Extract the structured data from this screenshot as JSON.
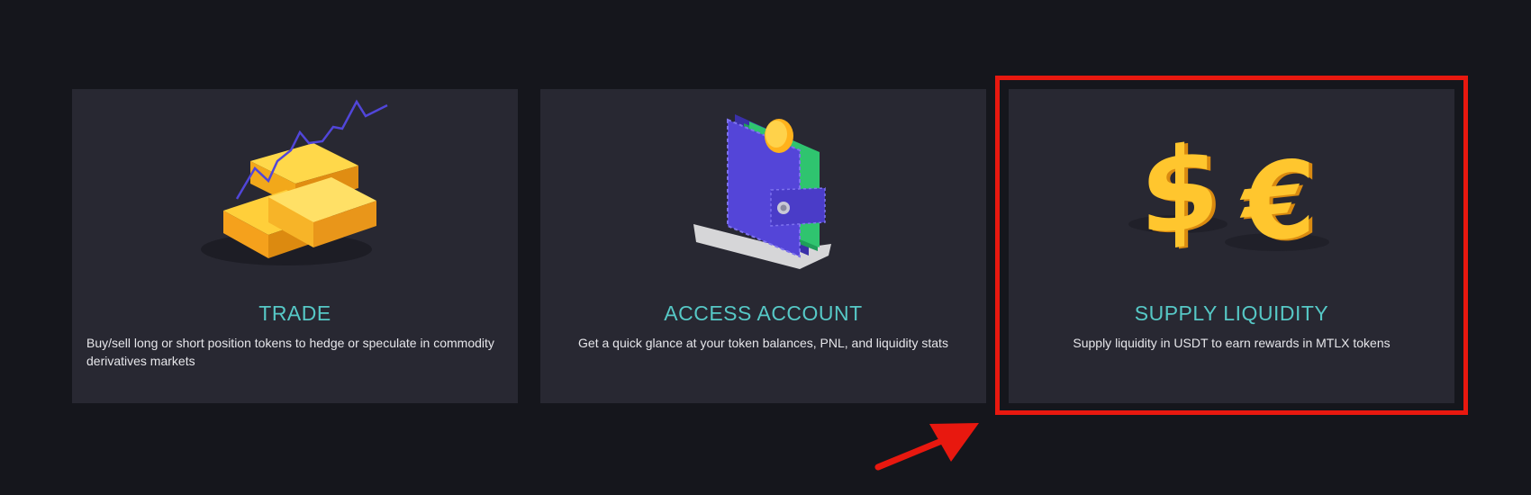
{
  "cards": [
    {
      "id": "trade",
      "icon": "gold-bars-chart-icon",
      "title": "TRADE",
      "description": "Buy/sell long or short position tokens to hedge or speculate in commodity derivatives markets"
    },
    {
      "id": "access-account",
      "icon": "wallet-icon",
      "title": "ACCESS ACCOUNT",
      "description": "Get a quick glance at your token balances, PNL, and liquidity stats"
    },
    {
      "id": "supply-liquidity",
      "icon": "dollar-euro-icon",
      "title": "SUPPLY LIQUIDITY",
      "description": "Supply liquidity in USDT to earn rewards in MTLX tokens"
    }
  ],
  "colors": {
    "background": "#15161c",
    "card": "#282832",
    "title_accent": "#56c8c6",
    "highlight": "#e8180f"
  }
}
